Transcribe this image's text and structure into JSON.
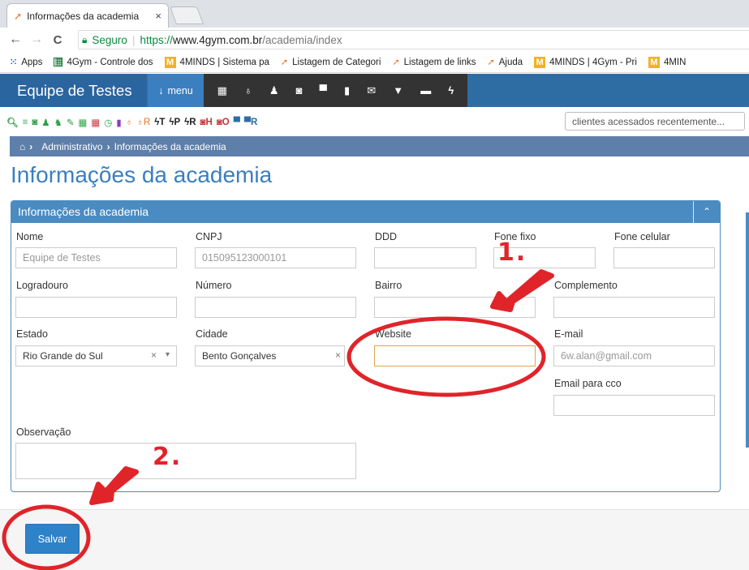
{
  "browser": {
    "tab_title": "Informações da academia",
    "tab_close": "×",
    "nav_back": "←",
    "nav_forward": "→",
    "nav_reload": "C",
    "secure_label": "Seguro",
    "url_protocol": "https://",
    "url_host": "www.4gym.com.br",
    "url_path": "/academia/index"
  },
  "bookmarks": [
    {
      "label": "Apps",
      "icon": "apps-grid-icon"
    },
    {
      "label": "4Gym - Controle dos",
      "icon": "google-sheet-icon"
    },
    {
      "label": "4MINDS | Sistema pa",
      "icon": "m-logo-icon"
    },
    {
      "label": "Listagem de Categori",
      "icon": "orange-logo-icon"
    },
    {
      "label": "Listagem de links",
      "icon": "orange-logo-icon"
    },
    {
      "label": "Ajuda",
      "icon": "orange-logo-icon"
    },
    {
      "label": "4MINDS | 4Gym - Pri",
      "icon": "m-logo-icon"
    },
    {
      "label": "4MIN",
      "icon": "m-logo-icon"
    }
  ],
  "app": {
    "brand": "Equipe de Testes",
    "menu_label": "menu",
    "recent_placeholder": "clientes acessados recentemente..."
  },
  "quick_labels": {
    "revenue_r": "R",
    "t": "T",
    "p": "P",
    "r": "R",
    "h": "H",
    "o": "O",
    "cart_r": "R"
  },
  "breadcrumb": {
    "home_sep": "›",
    "item1": "Administrativo",
    "sep": "›",
    "item2": "Informações da academia"
  },
  "page": {
    "title": "Informações da academia"
  },
  "panel": {
    "title": "Informações da academia",
    "collapse": "⌃"
  },
  "form": {
    "nome_label": "Nome",
    "nome_value": "Equipe de Testes",
    "cnpj_label": "CNPJ",
    "cnpj_value": "015095123000101",
    "ddd_label": "DDD",
    "fone_fixo_label": "Fone fixo",
    "fone_celular_label": "Fone celular",
    "logradouro_label": "Logradouro",
    "numero_label": "Número",
    "bairro_label": "Bairro",
    "complemento_label": "Complemento",
    "estado_label": "Estado",
    "estado_value": "Rio Grande do Sul",
    "cidade_label": "Cidade",
    "cidade_value": "Bento Gonçalves",
    "website_label": "Website",
    "email_label": "E-mail",
    "email_value": "6w.alan@gmail.com",
    "email_cco_label": "Email para cco",
    "observacao_label": "Observação",
    "clear": "×",
    "caret": "▾"
  },
  "footer": {
    "save_label": "Salvar"
  },
  "annotations": {
    "step1": "1.",
    "step2": "2.",
    "color": "#e0242a"
  }
}
